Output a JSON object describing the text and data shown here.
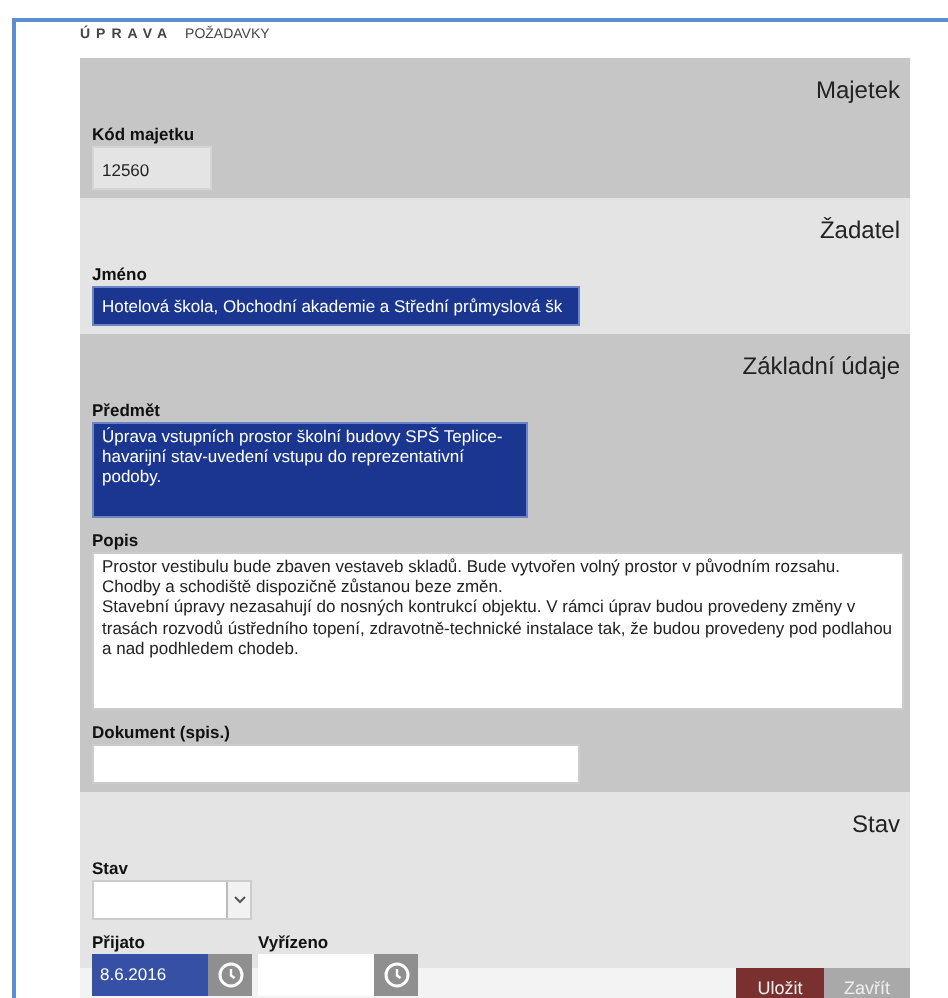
{
  "heading": {
    "title": "ÚPRAVA",
    "subtitle": "POŽADAVKY"
  },
  "sections": [
    {
      "title": "Majetek",
      "fields": [
        {
          "kind": "code",
          "label": "Kód majetku",
          "value": "12560",
          "readonly": true
        }
      ]
    },
    {
      "title": "Žadatel",
      "fields": [
        {
          "kind": "input",
          "label": "Jméno",
          "value": "Hotelová škola, Obchodní akademie a Střední průmyslová šk",
          "highlighted": true
        }
      ]
    },
    {
      "title": "Základní údaje",
      "fields": [
        {
          "kind": "note",
          "label": "Předmět",
          "value": "Úprava vstupních prostor školní budovy SPŠ Teplice-havarijní stav-uvedení vstupu do reprezentativní podoby.",
          "highlighted": true
        },
        {
          "kind": "textarea",
          "label": "Popis",
          "value": "Prostor vestibulu bude zbaven vestaveb skladů. Bude vytvořen volný prostor v původním rozsahu.\nChodby a schodiště dispozičně zůstanou beze změn.\nStavební úpravy nezasahují do nosných kontrukcí objektu. V rámci úprav budou provedeny změny v trasách rozvodů ústředního topení, zdravotně-technické instalace tak, že budou provedeny pod podlahou a nad podhledem chodeb.",
          "highlighted": false
        },
        {
          "kind": "input",
          "label": "Dokument (spis.)",
          "highlighted": false
        }
      ]
    },
    {
      "title": "Stav",
      "fields": [
        {
          "kind": "select",
          "label": "Stav"
        },
        {
          "kind": "dates",
          "items": [
            {
              "label": "Přijato",
              "value": "8.6.2016",
              "highlighted": true
            },
            {
              "label": "Vyřízeno",
              "highlighted": false
            }
          ]
        }
      ]
    }
  ],
  "buttons": [
    {
      "label": "Uložit",
      "kind": "primary"
    },
    {
      "label": "Zavřít",
      "kind": "secondary"
    }
  ]
}
